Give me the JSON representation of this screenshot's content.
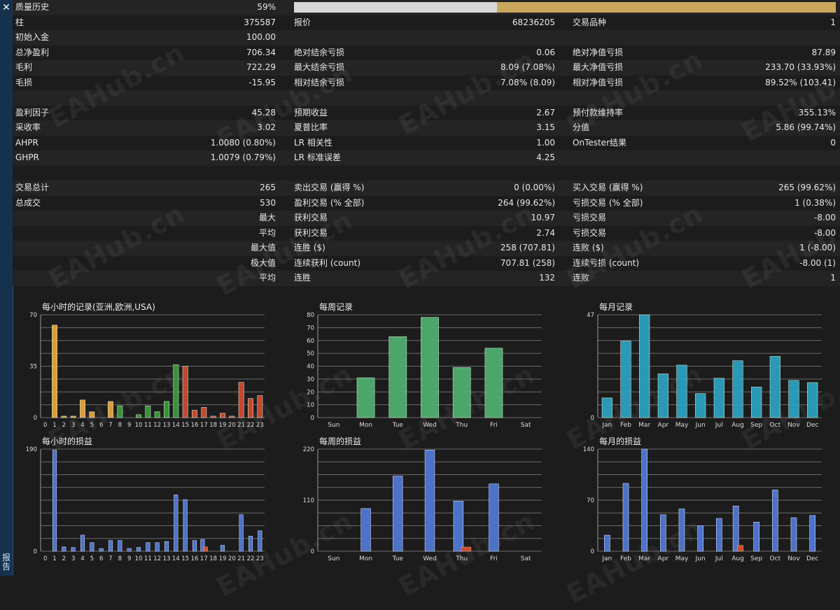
{
  "sidebar": {
    "close_glyph": "✕",
    "vertical_label": "报告"
  },
  "progress": {
    "label": "质量历史",
    "value_text": "59%",
    "fraction_filled": 0.59,
    "colors": {
      "track": "#d8d8d8",
      "fill": "#c9a75d"
    }
  },
  "rows": [
    {
      "c1": [
        "柱",
        "375587"
      ],
      "c2": [
        "报价",
        "68236205"
      ],
      "c3": [
        "交易品种",
        "1"
      ]
    },
    {
      "c1": [
        "初始入金",
        "100.00"
      ],
      "c2": [
        "",
        ""
      ],
      "c3": [
        "",
        ""
      ]
    },
    {
      "c1": [
        "总净盈利",
        "706.34"
      ],
      "c2": [
        "绝对结余亏损",
        "0.06"
      ],
      "c3": [
        "绝对净值亏损",
        "87.89"
      ]
    },
    {
      "c1": [
        "毛利",
        "722.29"
      ],
      "c2": [
        "最大结余亏损",
        "8.09 (7.08%)"
      ],
      "c3": [
        "最大净值亏损",
        "233.70 (33.93%)"
      ]
    },
    {
      "c1": [
        "毛损",
        "-15.95"
      ],
      "c2": [
        "相对结余亏损",
        "7.08% (8.09)"
      ],
      "c3": [
        "相对净值亏损",
        "89.52% (103.41)"
      ]
    },
    {
      "c1": [
        "",
        ""
      ],
      "c2": [
        "",
        ""
      ],
      "c3": [
        "",
        ""
      ]
    },
    {
      "c1": [
        "盈利因子",
        "45.28"
      ],
      "c2": [
        "预期收益",
        "2.67"
      ],
      "c3": [
        "预付款维持率",
        "355.13%"
      ]
    },
    {
      "c1": [
        "采收率",
        "3.02"
      ],
      "c2": [
        "夏普比率",
        "3.15"
      ],
      "c3": [
        "分值",
        "5.86 (99.74%)"
      ]
    },
    {
      "c1": [
        "AHPR",
        "1.0080 (0.80%)"
      ],
      "c2": [
        "LR 相关性",
        "1.00"
      ],
      "c3": [
        "OnTester结果",
        "0"
      ]
    },
    {
      "c1": [
        "GHPR",
        "1.0079 (0.79%)"
      ],
      "c2": [
        "LR 标准误差",
        "4.25"
      ],
      "c3": [
        "",
        ""
      ]
    },
    {
      "c1": [
        "",
        ""
      ],
      "c2": [
        "",
        ""
      ],
      "c3": [
        "",
        ""
      ]
    },
    {
      "c1": [
        "交易总计",
        "265"
      ],
      "c2": [
        "卖出交易 (赢得 %)",
        "0 (0.00%)"
      ],
      "c3": [
        "买入交易 (赢得 %)",
        "265 (99.62%)"
      ]
    },
    {
      "c1": [
        "总成交",
        "530"
      ],
      "c2": [
        "盈利交易 (% 全部)",
        "264 (99.62%)"
      ],
      "c3": [
        "亏损交易 (% 全部)",
        "1 (0.38%)"
      ]
    },
    {
      "c1": [
        "",
        "最大"
      ],
      "c2": [
        "获利交易",
        "10.97"
      ],
      "c3": [
        "亏损交易",
        "-8.00"
      ],
      "right_label": true
    },
    {
      "c1": [
        "",
        "平均"
      ],
      "c2": [
        "获利交易",
        "2.74"
      ],
      "c3": [
        "亏损交易",
        "-8.00"
      ],
      "right_label": true
    },
    {
      "c1": [
        "",
        "最大值"
      ],
      "c2": [
        "连胜 ($)",
        "258 (707.81)"
      ],
      "c3": [
        "连败 ($)",
        "1 (-8.00)"
      ],
      "right_label": true
    },
    {
      "c1": [
        "",
        "极大值"
      ],
      "c2": [
        "连续获利 (count)",
        "707.81 (258)"
      ],
      "c3": [
        "连续亏损 (count)",
        "-8.00 (1)"
      ],
      "right_label": true
    },
    {
      "c1": [
        "",
        "平均"
      ],
      "c2": [
        "连胜",
        "132"
      ],
      "c3": [
        "连败",
        "1"
      ],
      "right_label": true
    }
  ],
  "watermark_text": "EAHub.cn",
  "chart_data": [
    {
      "type": "bar",
      "title": "每小时的记录(亚洲,欧洲,USA)",
      "categories": [
        "0",
        "1",
        "2",
        "3",
        "4",
        "5",
        "6",
        "7",
        "8",
        "9",
        "10",
        "11",
        "12",
        "13",
        "14",
        "15",
        "16",
        "17",
        "18",
        "19",
        "20",
        "21",
        "22",
        "23"
      ],
      "values": [
        0,
        63,
        1,
        1,
        12,
        4,
        0,
        11,
        8,
        0,
        2,
        8,
        4,
        11,
        36,
        35,
        5,
        7,
        1,
        3,
        1,
        24,
        13,
        15
      ],
      "bar_colors": [
        "#e8a33a",
        "#e8a33a",
        "#e8a33a",
        "#e8a33a",
        "#e8a33a",
        "#e8a33a",
        "#e8a33a",
        "#e8a33a",
        "#3a9a3a",
        "#3a9a3a",
        "#3a9a3a",
        "#3a9a3a",
        "#3a9a3a",
        "#3a9a3a",
        "#3a9a3a",
        "#cc4b2e",
        "#cc4b2e",
        "#cc4b2e",
        "#cc4b2e",
        "#cc4b2e",
        "#cc4b2e",
        "#cc4b2e",
        "#cc4b2e",
        "#cc4b2e"
      ],
      "ylim": [
        0,
        70
      ],
      "yticks": [
        0,
        35,
        70
      ],
      "grid": true
    },
    {
      "type": "bar",
      "title": "每周记录",
      "categories": [
        "Sun",
        "Mon",
        "Tue",
        "Wed",
        "Thu",
        "Fri",
        "Sat"
      ],
      "values": [
        0,
        31,
        63,
        78,
        39,
        54,
        0
      ],
      "bar_color": "#4fae6e",
      "ylim": [
        0,
        80
      ],
      "yticks": [
        0,
        10,
        20,
        30,
        40,
        50,
        60,
        70,
        80
      ],
      "grid": true
    },
    {
      "type": "bar",
      "title": "每月记录",
      "categories": [
        "Jan",
        "Feb",
        "Mar",
        "Apr",
        "May",
        "Jun",
        "Jul",
        "Aug",
        "Sep",
        "Oct",
        "Nov",
        "Dec"
      ],
      "values": [
        9,
        35,
        47,
        20,
        24,
        11,
        18,
        26,
        14,
        28,
        17,
        16
      ],
      "bar_color": "#2aa0bf",
      "ylim": [
        0,
        47
      ],
      "yticks": [
        0,
        47
      ],
      "grid": true
    },
    {
      "type": "bar",
      "title": "每小时的损益",
      "categories": [
        "0",
        "1",
        "2",
        "3",
        "4",
        "5",
        "6",
        "7",
        "8",
        "9",
        "10",
        "11",
        "12",
        "13",
        "14",
        "15",
        "16",
        "17",
        "18",
        "19",
        "20",
        "21",
        "22",
        "23"
      ],
      "series": [
        {
          "values": [
            0,
            188,
            8,
            7,
            30,
            16,
            5,
            20,
            20,
            5,
            7,
            16,
            16,
            18,
            105,
            96,
            20,
            22,
            0,
            11,
            0,
            68,
            28,
            38
          ],
          "color": "#4d72c8"
        },
        {
          "values": [
            0,
            0,
            0,
            0,
            0,
            0,
            0,
            0,
            0,
            0,
            0,
            0,
            0,
            0,
            0,
            0,
            0,
            8,
            0,
            0,
            0,
            0,
            0,
            0
          ],
          "color": "#cc4b2e"
        }
      ],
      "ylim": [
        0,
        190
      ],
      "yticks": [
        0,
        190
      ],
      "grid": true
    },
    {
      "type": "bar",
      "title": "每周的损益",
      "categories": [
        "Sun",
        "Mon",
        "Tue",
        "Wed",
        "Thu",
        "Fri",
        "Sat"
      ],
      "series": [
        {
          "values": [
            0,
            92,
            162,
            218,
            108,
            145,
            0
          ],
          "color": "#4d72c8"
        },
        {
          "values": [
            0,
            0,
            0,
            0,
            9,
            0,
            0
          ],
          "color": "#cc4b2e"
        }
      ],
      "ylim": [
        0,
        220
      ],
      "yticks": [
        0,
        110,
        220
      ],
      "grid": true
    },
    {
      "type": "bar",
      "title": "每月的损益",
      "categories": [
        "Jan",
        "Feb",
        "Mar",
        "Apr",
        "May",
        "Jun",
        "Jul",
        "Aug",
        "Sep",
        "Oct",
        "Nov",
        "Dec"
      ],
      "series": [
        {
          "values": [
            22,
            93,
            140,
            50,
            58,
            35,
            45,
            62,
            40,
            84,
            46,
            49
          ],
          "color": "#4d72c8"
        },
        {
          "values": [
            0,
            0,
            0,
            0,
            0,
            0,
            0,
            8,
            0,
            0,
            0,
            0
          ],
          "color": "#cc4b2e"
        }
      ],
      "ylim": [
        0,
        140
      ],
      "yticks": [
        0,
        70,
        140
      ],
      "grid": true
    }
  ]
}
